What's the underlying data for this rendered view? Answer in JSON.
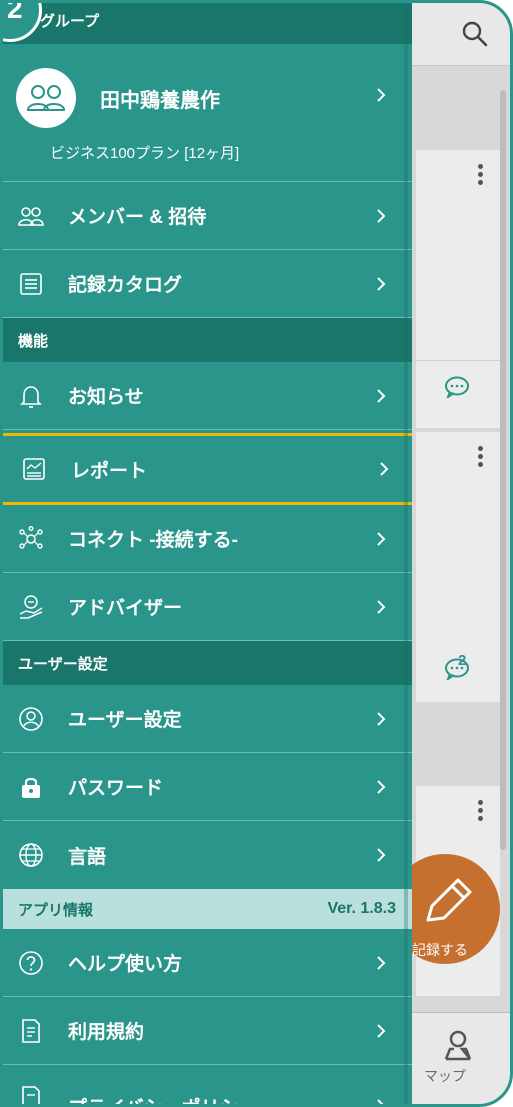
{
  "drawer": {
    "group_title": "グループ",
    "step_badge": "2",
    "org": {
      "name": "田中鶏養農作",
      "plan": "ビジネス100プラン [12ヶ月]"
    },
    "menu_top": [
      {
        "label": "メンバー & 招待",
        "icon": "members-icon"
      },
      {
        "label": "記録カタログ",
        "icon": "catalog-list-icon"
      }
    ],
    "section_features": "機能",
    "menu_features": [
      {
        "label": "お知らせ",
        "icon": "bell-icon"
      },
      {
        "label": "レポート",
        "icon": "report-chart-icon"
      },
      {
        "label": "コネクト -接続する-",
        "icon": "network-icon"
      },
      {
        "label": "アドバイザー",
        "icon": "advisor-icon"
      }
    ],
    "section_user": "ユーザー設定",
    "menu_user": [
      {
        "label": "ユーザー設定",
        "icon": "user-circle-icon"
      },
      {
        "label": "パスワード",
        "icon": "lock-icon"
      },
      {
        "label": "言語",
        "icon": "globe-icon"
      }
    ],
    "section_app": "アプリ情報",
    "version": "Ver. 1.8.3",
    "menu_app": [
      {
        "label": "ヘルプ使い方",
        "icon": "help-icon"
      },
      {
        "label": "利用規約",
        "icon": "terms-document-icon"
      },
      {
        "label": "プライバシーポリシー",
        "icon": "privacy-document-icon"
      }
    ]
  },
  "background_app": {
    "comment_count": "2",
    "fab_label": "記録する",
    "bottom_tab": "マップ"
  },
  "colors": {
    "teal": "#2a958a",
    "teal_dark": "#1a766b",
    "highlight": "#f2b705",
    "fab": "#c5702e"
  }
}
